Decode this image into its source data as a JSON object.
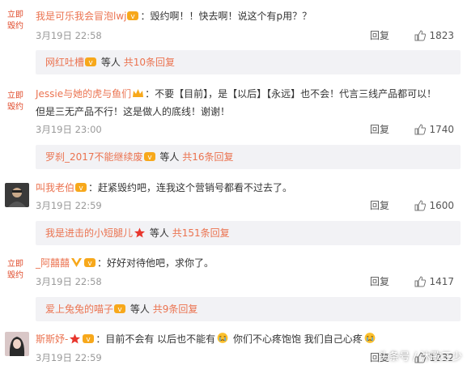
{
  "comments": [
    {
      "avatar_text": [
        "立即",
        "毁约"
      ],
      "name": "我是可乐我会冒泡lwj",
      "badge": "vip-badge",
      "text": "：毁约啊！！快去啊！说这个有p用？？",
      "time": "3月19日 22:58",
      "reply_label": "回复",
      "likes": "1823",
      "reply_name": "网红吐槽",
      "reply_mid": "等人",
      "reply_count": "共10条回复"
    },
    {
      "avatar_text": [
        "立即",
        "毁约"
      ],
      "name": "Jessie与她的虎与鱼们",
      "badge": "crown-badge",
      "text": "：不要【目前】，是【以后】【永远】也不会！代言三线产品都可以！",
      "text2": "但是三无产品不行！这是做人的底线！谢谢！",
      "time": "3月19日 23:00",
      "reply_label": "回复",
      "likes": "1740",
      "reply_name": "罗刹_2017不能继续废",
      "reply_mid": "等人",
      "reply_count": "共16条回复"
    },
    {
      "name": "叫我老伯",
      "badge": "vip-badge",
      "text": "：赶紧毁约吧，连我这个营销号都看不过去了。",
      "time": "3月19日 22:59",
      "reply_label": "回复",
      "likes": "1600",
      "reply_name": "我是进击的小短腿儿",
      "reply_mid": "等人",
      "reply_count": "共151条回复"
    },
    {
      "avatar_text": [
        "立即",
        "毁约"
      ],
      "name": "_阿囍囍",
      "badge": "vip-badge",
      "text": "：好好对待他吧，求你了。",
      "time": "3月19日 22:58",
      "reply_label": "回复",
      "likes": "1417",
      "reply_name": "爱上兔兔的喵子",
      "reply_mid": "等人",
      "reply_count": "共9条回复"
    },
    {
      "name": "斯斯妤-",
      "badge": "vip-badge",
      "text_parts": [
        "：目前不会有  以后也不能有",
        " 你们不心疼饱饱  我们自己心疼"
      ],
      "time": "3月19日 22:59",
      "reply_label": "回复",
      "likes": "1232"
    }
  ],
  "watermark": "头条号 / 沐歌三少",
  "colors": {
    "name": "#eb7350",
    "reply_bg": "#f2f2f5",
    "badge": "#f7a81b"
  }
}
